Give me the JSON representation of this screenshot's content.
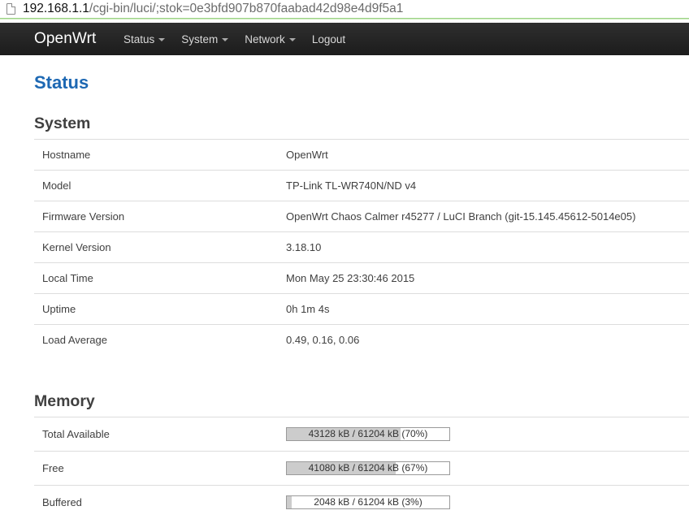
{
  "address_bar": {
    "url_host": "192.168.1.1",
    "url_path": "/cgi-bin/luci/;stok=0e3bfd907b870faabad42d98e4d9f5a1"
  },
  "navbar": {
    "brand": "OpenWrt",
    "items": [
      {
        "label": "Status",
        "has_dropdown": true
      },
      {
        "label": "System",
        "has_dropdown": true
      },
      {
        "label": "Network",
        "has_dropdown": true
      },
      {
        "label": "Logout",
        "has_dropdown": false
      }
    ]
  },
  "page_title": "Status",
  "system": {
    "title": "System",
    "rows": [
      {
        "label": "Hostname",
        "value": "OpenWrt"
      },
      {
        "label": "Model",
        "value": "TP-Link TL-WR740N/ND v4"
      },
      {
        "label": "Firmware Version",
        "value": "OpenWrt Chaos Calmer r45277 / LuCI Branch (git-15.145.45612-5014e05)"
      },
      {
        "label": "Kernel Version",
        "value": "3.18.10"
      },
      {
        "label": "Local Time",
        "value": "Mon May 25 23:30:46 2015"
      },
      {
        "label": "Uptime",
        "value": "0h 1m 4s"
      },
      {
        "label": "Load Average",
        "value": "0.49, 0.16, 0.06"
      }
    ]
  },
  "memory": {
    "title": "Memory",
    "rows": [
      {
        "label": "Total Available",
        "bar_text": "43128 kB / 61204 kB (70%)",
        "percent": 70
      },
      {
        "label": "Free",
        "bar_text": "41080 kB / 61204 kB (67%)",
        "percent": 67
      },
      {
        "label": "Buffered",
        "bar_text": "2048 kB / 61204 kB (3%)",
        "percent": 3
      }
    ]
  },
  "colors": {
    "title_blue": "#1d68b3",
    "navbar_bg": "#222222",
    "bar_fill": "#cccccc"
  }
}
